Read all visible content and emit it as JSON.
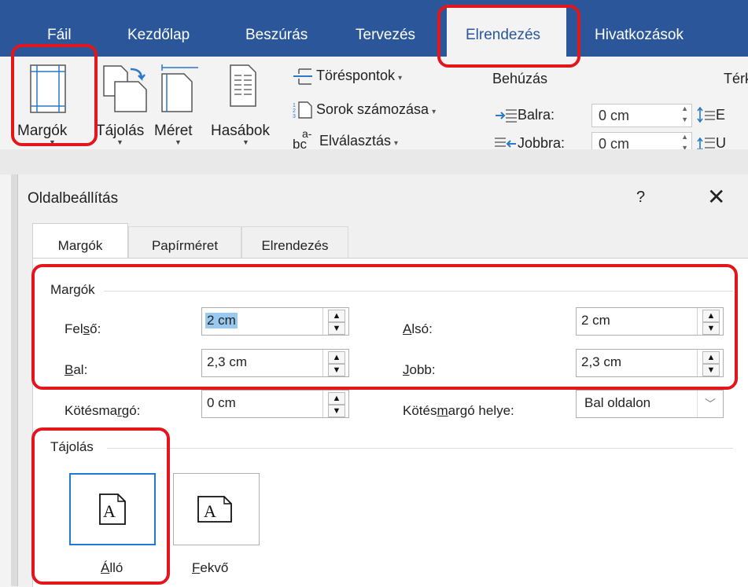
{
  "ribbon_tabs": {
    "file": "Fáil",
    "home": "Kezdőlap",
    "insert": "Beszúrás",
    "design": "Tervezés",
    "layout": "Elrendezés",
    "references": "Hivatkozások"
  },
  "ribbon": {
    "margins": "Margók",
    "orientation": "Tájolás",
    "size": "Méret",
    "columns": "Hasábok",
    "breaks": "Töréspontok",
    "line_numbers": "Sorok számozása",
    "hyphenation": "Elválasztás",
    "hyphen_icon_a": "a-",
    "hyphen_icon_bc": "bc",
    "indent_header": "Behúzás",
    "spacing_header": "Térkö",
    "indent_left_label": "Balra:",
    "indent_left_value": "0 cm",
    "indent_right_label": "Jobbra:",
    "indent_right_value": "0 cm",
    "spacing_before_partial": "E",
    "spacing_after_partial": "U"
  },
  "dialog": {
    "title": "Oldalbeállítás",
    "help": "?",
    "close": "✕",
    "tabs": [
      "Margók",
      "Papírméret",
      "Elrendezés"
    ],
    "margins_group": "Margók",
    "top_label": "Felső:",
    "top_value": "2 cm",
    "bottom_label": "Alsó:",
    "bottom_value": "2 cm",
    "left_label": "Bal:",
    "left_value": "2,3 cm",
    "right_label": "Jobb:",
    "right_value": "2,3 cm",
    "gutter_label": "Kötésmargó:",
    "gutter_value": "0 cm",
    "gutter_pos_label": "Kötésmargó helye:",
    "gutter_pos_value": "Bal oldalon",
    "orientation_group": "Tájolás",
    "portrait": "Álló",
    "landscape": "Fekvő",
    "page_glyph": "A"
  },
  "colors": {
    "ribbon_blue": "#2b579a",
    "highlight_red": "#e2161b",
    "selection_blue": "#1f7ad0"
  }
}
